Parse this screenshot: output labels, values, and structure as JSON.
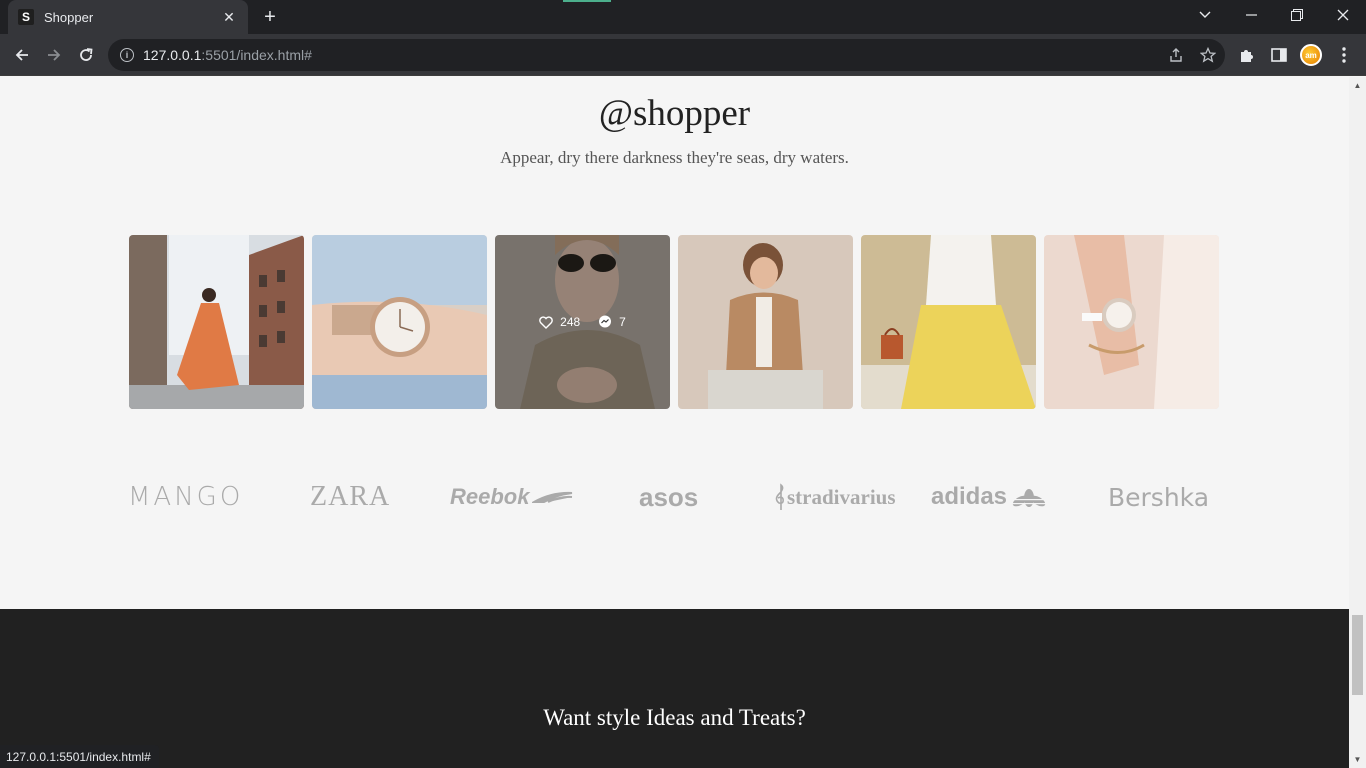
{
  "browser": {
    "tab_favicon": "S",
    "tab_title": "Shopper",
    "url_host": "127.0.0.1",
    "url_rest": ":5501/index.html#",
    "status_url": "127.0.0.1:5501/index.html#",
    "profile_initials": "am"
  },
  "instagram": {
    "handle": "@shopper",
    "tagline": "Appear, dry there darkness they're seas, dry waters.",
    "hovered_likes": "248",
    "hovered_comments": "7"
  },
  "brands": [
    "MANGO",
    "ZARA",
    "Reebok",
    "asos",
    "stradivarius",
    "adidas",
    "Bershka"
  ],
  "footer": {
    "title": "Want style Ideas and Treats?"
  },
  "icons": {
    "back": "arrow-left-icon",
    "forward": "arrow-right-icon",
    "reload": "reload-icon",
    "share": "share-icon",
    "bookmark": "star-icon",
    "extensions": "puzzle-icon",
    "sidepanel": "side-panel-icon",
    "menu": "kebab-menu-icon"
  }
}
